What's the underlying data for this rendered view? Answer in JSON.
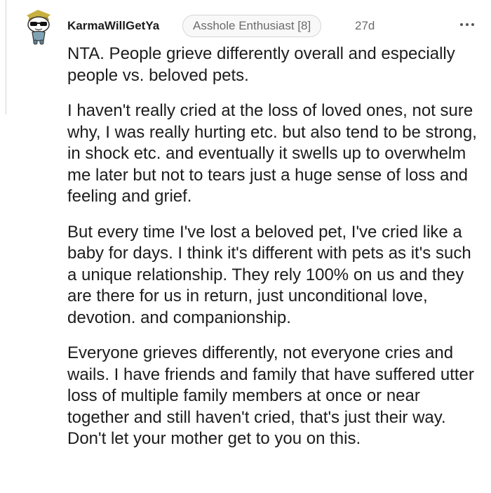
{
  "comment": {
    "author": "KarmaWillGetYa",
    "flair": "Asshole Enthusiast [8]",
    "age": "27d",
    "avatar_icon": "snoo-sunglasses-avatar-icon",
    "more_icon": "more-options-icon",
    "paragraphs": [
      "NTA. People grieve differently overall and especially people vs. beloved pets.",
      "I haven't really cried at the loss of loved ones, not sure why, I was really hurting etc. but also tend to be strong, in shock etc. and eventually it swells up to overwhelm me later but not to tears just a huge sense of loss and feeling and grief.",
      "But every time I've lost a beloved pet, I've cried like a baby for days. I think it's different with pets as it's such a unique relationship. They rely 100% on us and they are there for us in return, just unconditional love, devotion. and companionship.",
      "Everyone grieves differently, not everyone cries and wails. I have friends and family that have suffered utter loss of multiple family members at once or near together and still haven't cried, that's just their way. Don't let your mother get to you on this."
    ]
  }
}
